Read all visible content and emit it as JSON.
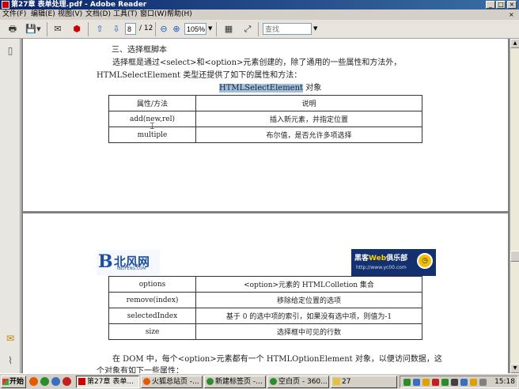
{
  "window": {
    "title": "第27章 表单处理.pdf - Adobe Reader",
    "minimize": "_",
    "maximize": "□",
    "close": "×"
  },
  "menu": {
    "items": [
      "文件(F)",
      "编辑(E)",
      "视图(V)",
      "文档(D)",
      "工具(T)",
      "窗口(W)",
      "帮助(H)"
    ],
    "doc_close": "×"
  },
  "toolbar": {
    "page_current": "8",
    "page_total": "/ 12",
    "zoom": "105%",
    "search_placeholder": "查找"
  },
  "page1": {
    "heading": "三、选择框脚本",
    "para_line1": "选择框是通过<select>和<option>元素创建的，除了通用的一些属性和方法外，",
    "para_line2": "HTMLSelectElement 类型还提供了如下的属性和方法：",
    "caption_highlight": "HTMLSelectElement",
    "caption_rest": " 对象",
    "table": {
      "headers": [
        "属性/方法",
        "说明"
      ],
      "rows": [
        [
          "add(new,rel)",
          "插入新元素，并指定位置"
        ],
        [
          "multiple",
          "布尔值，是否允许多项选择"
        ]
      ]
    }
  },
  "page2": {
    "logo_left": {
      "name": "北风网",
      "sub": "IBEIFENG.COM"
    },
    "logo_right": {
      "name_a": "黑客",
      "name_b": "Web",
      "name_c": "俱乐部",
      "sub": "http://www.yc00.com"
    },
    "table": {
      "rows": [
        [
          "options",
          "<option>元素的 HTMLColletion 集合"
        ],
        [
          "remove(index)",
          "移除给定位置的选项"
        ],
        [
          "selectedIndex",
          "基于 0 的选中项的索引，如果没有选中项，则值为-1"
        ],
        [
          "size",
          "选择框中可见的行数"
        ]
      ]
    },
    "para_line1": "在 DOM 中，每个<option>元素都有一个 HTMLOptionElement 对象，以便访问数据，这",
    "para_line2": "个对象有如下一些属性："
  },
  "taskbar": {
    "start": "开始",
    "tasks": [
      "第27章 表单...",
      "火狐总站页 -...",
      "新建标签页 -...",
      "空白页 - 360...",
      "27"
    ],
    "clock": "15:18"
  },
  "colors": {
    "titlebar": "#0a246a",
    "highlight": "#9fbfe0",
    "logo_blue": "#1d4f9e"
  }
}
